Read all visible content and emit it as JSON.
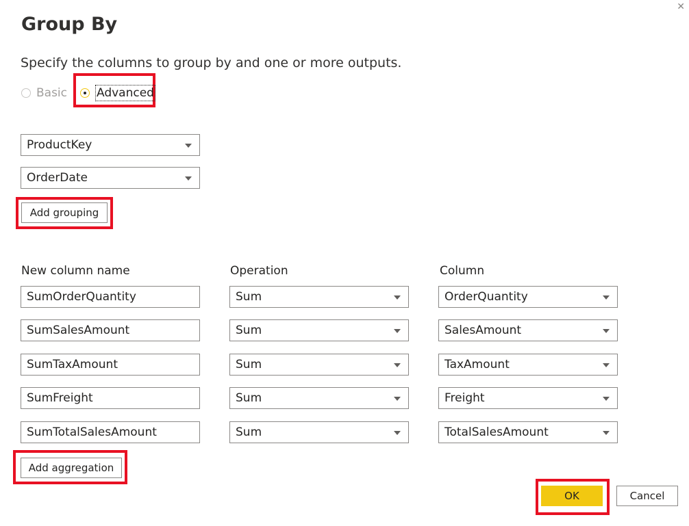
{
  "dialog": {
    "title": "Group By",
    "subtitle": "Specify the columns to group by and one or more outputs.",
    "close_glyph": "✕"
  },
  "mode": {
    "basic_label": "Basic",
    "advanced_label": "Advanced",
    "selected": "Advanced"
  },
  "grouping": {
    "columns": [
      "ProductKey",
      "OrderDate"
    ],
    "add_label": "Add grouping"
  },
  "aggregations": {
    "headers": {
      "name": "New column name",
      "operation": "Operation",
      "column": "Column"
    },
    "rows": [
      {
        "name": "SumOrderQuantity",
        "operation": "Sum",
        "column": "OrderQuantity"
      },
      {
        "name": "SumSalesAmount",
        "operation": "Sum",
        "column": "SalesAmount"
      },
      {
        "name": "SumTaxAmount",
        "operation": "Sum",
        "column": "TaxAmount"
      },
      {
        "name": "SumFreight",
        "operation": "Sum",
        "column": "Freight"
      },
      {
        "name": "SumTotalSalesAmount",
        "operation": "Sum",
        "column": "TotalSalesAmount"
      }
    ],
    "add_label": "Add aggregation"
  },
  "footer": {
    "ok_label": "OK",
    "cancel_label": "Cancel"
  },
  "colors": {
    "accent": "#f2c811",
    "callout": "#e81123",
    "border": "#8a8886"
  }
}
